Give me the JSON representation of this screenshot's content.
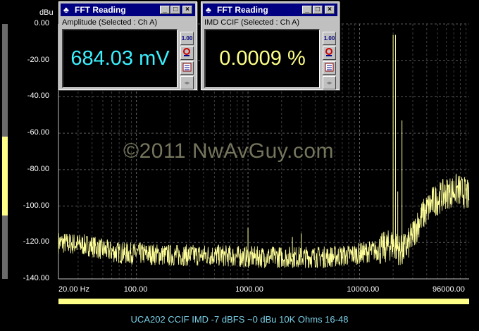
{
  "windows": [
    {
      "title": "FFT Reading",
      "subtitle": "Amplitude (Selected : Ch A)",
      "value": "684.03 mV",
      "color": "#3cf0ff"
    },
    {
      "title": "FFT Reading",
      "subtitle": "IMD CCIF (Selected : Ch A)",
      "value": "0.0009 %",
      "color": "#ffff88"
    }
  ],
  "window_buttons": {
    "minimize": "_",
    "maximize": "□",
    "close": "×"
  },
  "side_buttons": {
    "scale": "1.00",
    "icons": [
      "scale-icon",
      "probe-icon",
      "notepad-icon",
      "arrows-icon"
    ]
  },
  "watermark": "©2011 NwAvGuy.com",
  "caption": "UCA202 CCIF IMD -7 dBFS ~0 dBu 10K Ohms 16-48",
  "chart_data": {
    "type": "line",
    "y_unit": "dBu",
    "yticks": [
      "0.00",
      "-20.00",
      "-40.00",
      "-60.00",
      "-80.00",
      "-100.00",
      "-120.00",
      "-140.00"
    ],
    "ylim": [
      -140,
      0
    ],
    "xticks": [
      "20.00 Hz",
      "100.00",
      "1000.00",
      "10000.00",
      "96000.00"
    ],
    "x_scale": "log",
    "xlim": [
      20,
      96000
    ],
    "grid": true,
    "trace_color": "#ffff99",
    "series": [
      {
        "x": [
          20,
          30,
          40,
          50,
          60,
          80,
          100,
          200,
          500,
          1000,
          2000,
          5000,
          8000,
          10000,
          15000,
          18000,
          20000,
          24000,
          28000,
          35000,
          45000,
          60000,
          75000,
          90000,
          96000
        ],
        "y": [
          -120,
          -121,
          -122,
          -124,
          -125,
          -126,
          -126,
          -127,
          -127,
          -128,
          -128,
          -128,
          -127,
          -126,
          -124,
          -122,
          -121,
          -125,
          -120,
          -107,
          -98,
          -93,
          -91,
          -93,
          -96
        ]
      }
    ],
    "spurs": [
      {
        "x": 20000,
        "y": -6
      },
      {
        "x": 21000,
        "y": -6
      },
      {
        "x": 22000,
        "y": -92
      },
      {
        "x": 24000,
        "y": -53
      },
      {
        "x": 1000,
        "y": -112
      },
      {
        "x": 3000,
        "y": -115
      },
      {
        "x": 2500,
        "y": -117
      }
    ]
  }
}
